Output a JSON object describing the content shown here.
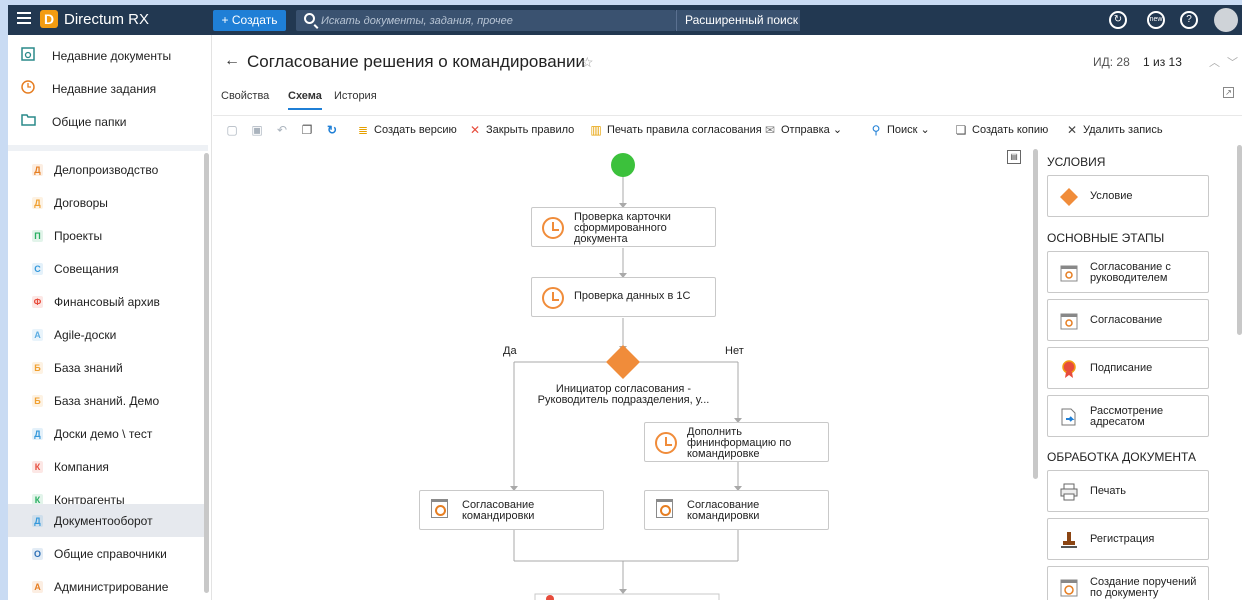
{
  "app": {
    "name": "Directum RX",
    "create_label": "+ Создать",
    "search_placeholder": "Искать документы, задания, прочее",
    "advanced_search": "Расширенный поиск"
  },
  "sidebar": {
    "top_items": [
      {
        "label": "Недавние документы",
        "icon": "recent-documents-icon"
      },
      {
        "label": "Недавние задания",
        "icon": "recent-tasks-icon"
      },
      {
        "label": "Общие папки",
        "icon": "folder-icon"
      }
    ],
    "modules": [
      {
        "letter": "Д",
        "label": "Делопроизводство",
        "color": "#e67e22"
      },
      {
        "letter": "Д",
        "label": "Договоры",
        "color": "#f0a030"
      },
      {
        "letter": "П",
        "label": "Проекты",
        "color": "#27ae60"
      },
      {
        "letter": "С",
        "label": "Совещания",
        "color": "#3498db"
      },
      {
        "letter": "Ф",
        "label": "Финансовый архив",
        "color": "#e74c3c"
      },
      {
        "letter": "A",
        "label": "Agile-доски",
        "color": "#5dade2"
      },
      {
        "letter": "Б",
        "label": "База знаний",
        "color": "#f0a030"
      },
      {
        "letter": "Б",
        "label": "База знаний. Демо",
        "color": "#f0a030"
      },
      {
        "letter": "Д",
        "label": "Доски демо \\ тест",
        "color": "#3498db"
      },
      {
        "letter": "К",
        "label": "Компания",
        "color": "#e74c3c"
      },
      {
        "letter": "К",
        "label": "Контрагенты",
        "color": "#27ae60"
      },
      {
        "letter": "Д",
        "label": "Документооборот",
        "color": "#3498db"
      },
      {
        "letter": "О",
        "label": "Общие справочники",
        "color": "#2c6fb5"
      },
      {
        "letter": "А",
        "label": "Администрирование",
        "color": "#e67e22"
      }
    ]
  },
  "record": {
    "title": "Согласование решения о командировании",
    "id_label": "ИД: 28",
    "position": "1 из 13"
  },
  "tabs": [
    "Свойства",
    "Схема",
    "История"
  ],
  "toolbar": {
    "create_version": "Создать версию",
    "close_rule": "Закрыть правило",
    "print_rules": "Печать правила согласования",
    "send": "Отправка",
    "search": "Поиск",
    "create_copy": "Создать копию",
    "delete": "Удалить запись"
  },
  "diagram": {
    "nodes": [
      {
        "text": "Проверка карточки сформированного документа",
        "lines": [
          "Проверка карточки",
          "сформированного",
          "документа"
        ]
      },
      {
        "text": "Проверка данных в 1С",
        "lines": [
          "Проверка данных в 1С"
        ]
      },
      {
        "text": "Дополнить фининформацию по командировке",
        "lines": [
          "Дополнить",
          "фининформацию по",
          "командировке"
        ]
      },
      {
        "text": "Согласование командировки",
        "lines": [
          "Согласование",
          "командировки"
        ]
      },
      {
        "text": "Согласование командировки",
        "lines": [
          "Согласование",
          "командировки"
        ]
      }
    ],
    "condition_lines": [
      "Инициатор согласования -",
      "Руководитель подразделения, у..."
    ],
    "yes_label": "Да",
    "no_label": "Нет"
  },
  "palette": {
    "sections": [
      "УСЛОВИЯ",
      "ОСНОВНЫЕ ЭТАПЫ",
      "ОБРАБОТКА ДОКУМЕНТА"
    ],
    "conditions": [
      {
        "label": "Условие"
      }
    ],
    "main_stages": [
      {
        "lines": [
          "Согласование с",
          "руководителем"
        ]
      },
      {
        "lines": [
          "Согласование"
        ]
      },
      {
        "lines": [
          "Подписание"
        ]
      },
      {
        "lines": [
          "Рассмотрение",
          "адресатом"
        ]
      }
    ],
    "doc_processing": [
      {
        "lines": [
          "Печать"
        ]
      },
      {
        "lines": [
          "Регистрация"
        ]
      },
      {
        "lines": [
          "Создание поручений",
          "по документу"
        ]
      }
    ]
  }
}
